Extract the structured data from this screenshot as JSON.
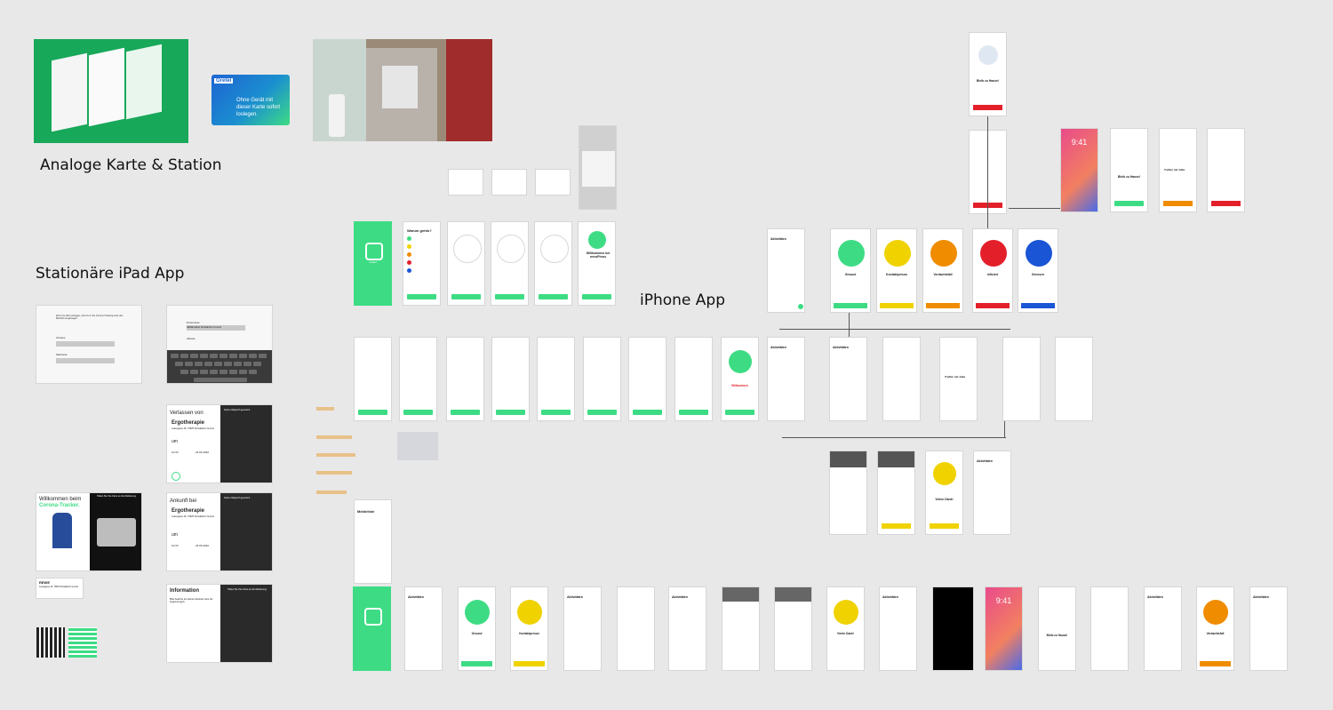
{
  "section_titles": {
    "analog": "Analoge Karte & Station",
    "ipad": "Stationäre iPad App",
    "iphone": "iPhone App"
  },
  "gretel_card": {
    "brand": "Gretel",
    "tagline": "Ohne Gerät mit dieser Karte sofort loslegen."
  },
  "ipad_screens": {
    "login_note": "Wenn du dich einloggst, wirst du in die Corona-Tracking-Liste des Betriebs eingetragen.",
    "field_name": "Vorname",
    "field_last": "Nachname",
    "address_label": "Firmenname",
    "address_value": "REWE Markt Schwäbisch Gmünd",
    "address2": "Adresse",
    "leave_title": "Verlassen von",
    "leave_place": "Ergotherapie",
    "leave_addr": "Ledergasse 45, 73525 Schwäbisch Gmünd",
    "um": "um",
    "time1": "10:33",
    "date1": "23.06.2020",
    "arrive_title": "Ankunft bei",
    "arrive_place": "Ergotherapie",
    "arrive_addr": "Ledergasse 45, 73525 Schwäbisch Gmünd",
    "time2": "10:33",
    "date2": "23.06.2020",
    "scan_label": "Karte erfolgreich gescannt",
    "info_title": "Information",
    "info_text": "Bitte beachte bei deinem Einkauf stets die Hygieneregeln.",
    "hold_card": "Halten Sie Ihre Karte an die Markierung",
    "welcome_line1": "Willkommen beim",
    "welcome_line2": "Corona-Tracker.",
    "rewe": "REWE",
    "rewe_addr": "Ledergasse 45, 73525 Schwäbisch Gmünd"
  },
  "onboarding": {
    "why_title": "Warum gehts?",
    "welcome_title": "Willkommen bei nevoPhrus",
    "gretel": "Gretel",
    "weiter": "Weiter"
  },
  "status_screens": [
    {
      "name": "Gesund",
      "color": "#3ddc84"
    },
    {
      "name": "Kontaktperson",
      "color": "#f0d200"
    },
    {
      "name": "Verdachtsfall",
      "color": "#f08c00"
    },
    {
      "name": "Infiziert",
      "color": "#e3202a"
    },
    {
      "name": "Genesen",
      "color": "#1a55d6"
    }
  ],
  "misc": {
    "aktivitaeten": "Aktivitäten",
    "bleib_zuhause": "Bleib zu Hause!",
    "treffen": "Treffen mit Julia",
    "vielen_dank": "Vielen Dank!",
    "meldeliste": "Meldeliste",
    "willkommen": "Willkommen",
    "time_941": "9:41"
  },
  "colors": {
    "green": "#3ddc84",
    "yellow": "#f0d200",
    "orange": "#f08c00",
    "red": "#e3202a",
    "blue": "#1a55d6",
    "canvas": "#e8e8e8"
  }
}
